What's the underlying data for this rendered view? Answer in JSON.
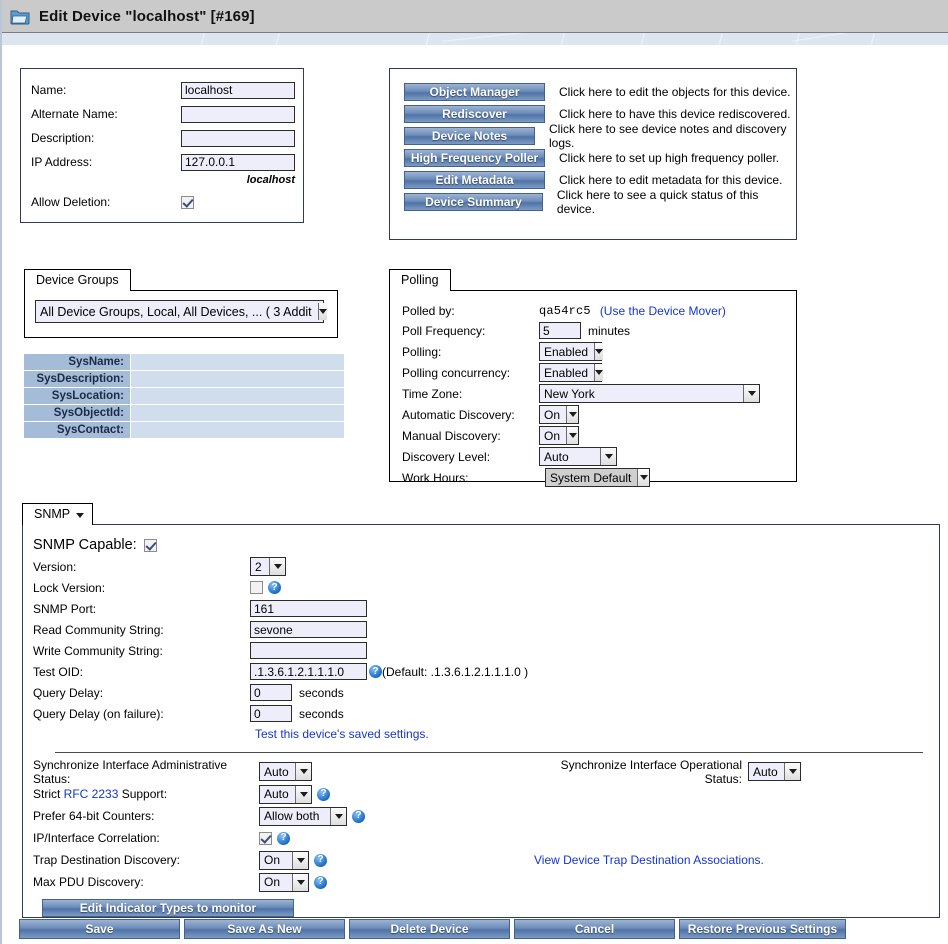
{
  "window": {
    "title": "Edit Device \"localhost\" [#169]",
    "icon": "folder-icon"
  },
  "device_info": {
    "fields": [
      {
        "label": "Name:",
        "value": "localhost",
        "placeholder": ""
      },
      {
        "label": "Alternate Name:",
        "value": "",
        "placeholder": ""
      },
      {
        "label": "Description:",
        "value": "",
        "placeholder": ""
      },
      {
        "label": "IP Address:",
        "value": "127.0.0.1",
        "placeholder": ""
      }
    ],
    "resolved_host": "localhost",
    "allow_deletion_label": "Allow Deletion:",
    "allow_deletion_checked": true
  },
  "actions": [
    {
      "button": "Object Manager",
      "description": "Click here to edit the objects for this device."
    },
    {
      "button": "Rediscover",
      "description": "Click here to have this device rediscovered."
    },
    {
      "button": "Device Notes",
      "description": "Click here to see device notes and discovery logs."
    },
    {
      "button": "High Frequency Poller",
      "description": "Click here to set up high frequency poller."
    },
    {
      "button": "Edit Metadata",
      "description": "Click here to edit metadata for this device."
    },
    {
      "button": "Device Summary",
      "description": "Click here to see a quick status of this device."
    }
  ],
  "device_groups": {
    "tab_label": "Device Groups",
    "selected": "All Device Groups, Local, All Devices, ... ( 3 Addit"
  },
  "sys_table": [
    {
      "label": "SysName:",
      "value": ""
    },
    {
      "label": "SysDescription:",
      "value": ""
    },
    {
      "label": "SysLocation:",
      "value": ""
    },
    {
      "label": "SysObjectId:",
      "value": ""
    },
    {
      "label": "SysContact:",
      "value": ""
    }
  ],
  "polling": {
    "tab_label": "Polling",
    "polled_by_label": "Polled by:",
    "polled_by_value": "qa54rc5",
    "device_mover_link": "(Use the Device Mover)",
    "poll_frequency_label": "Poll Frequency:",
    "poll_frequency_value": "5",
    "poll_frequency_unit": "minutes",
    "polling_label": "Polling:",
    "polling_value": "Enabled",
    "concurrency_label": "Polling concurrency:",
    "concurrency_value": "Enabled",
    "timezone_label": "Time Zone:",
    "timezone_value": "New York",
    "auto_discovery_label": "Automatic Discovery:",
    "auto_discovery_value": "On",
    "manual_discovery_label": "Manual Discovery:",
    "manual_discovery_value": "On",
    "discovery_level_label": "Discovery Level:",
    "discovery_level_value": "Auto",
    "work_hours_label": "Work Hours:",
    "work_hours_value": "System Default"
  },
  "snmp": {
    "tab_label": "SNMP",
    "capable_label": "SNMP Capable:",
    "capable_checked": true,
    "version_label": "Version:",
    "version_value": "2",
    "lock_version_label": "Lock Version:",
    "lock_version_checked": false,
    "port_label": "SNMP Port:",
    "port_value": "161",
    "read_community_label": "Read Community String:",
    "read_community_value": "sevone",
    "write_community_label": "Write Community String:",
    "write_community_value": "",
    "test_oid_label": "Test OID:",
    "test_oid_value": ".1.3.6.1.2.1.1.1.0",
    "test_oid_default": "(Default: .1.3.6.1.2.1.1.1.0 )",
    "query_delay_label": "Query Delay:",
    "query_delay_value": "0",
    "query_delay_unit": "seconds",
    "query_delay_fail_label": "Query Delay (on failure):",
    "query_delay_fail_value": "0",
    "query_delay_fail_unit": "seconds",
    "test_settings_link": "Test this device's saved settings.",
    "sync_admin_label": "Synchronize Interface Administrative Status:",
    "sync_admin_value": "Auto",
    "sync_oper_label": "Synchronize Interface Operational Status:",
    "sync_oper_value": "Auto",
    "strict_rfc_label_pre": "Strict ",
    "strict_rfc_link": "RFC 2233",
    "strict_rfc_label_post": " Support:",
    "strict_rfc_value": "Auto",
    "prefer64_label": "Prefer 64-bit Counters:",
    "prefer64_value": "Allow both",
    "ip_correlation_label": "IP/Interface Correlation:",
    "ip_correlation_checked": true,
    "trap_dest_label": "Trap Destination Discovery:",
    "trap_dest_value": "On",
    "max_pdu_label": "Max PDU Discovery:",
    "max_pdu_value": "On",
    "trap_assoc_link": "View Device Trap Destination Associations.",
    "edit_indicator_button": "Edit Indicator Types to monitor"
  },
  "footer": {
    "buttons": [
      "Save",
      "Save As New",
      "Delete Device",
      "Cancel",
      "Restore Previous Settings"
    ]
  },
  "colors": {
    "titlebar": "#cacaca",
    "band": "#dde6f0",
    "panel_border": "#323a5e",
    "input_bg": "#eeeefb",
    "button_blue": "#4f73a6",
    "link": "#1535cf",
    "sys_label_bg": "#a4bcd7",
    "sys_value_bg": "#cfdded"
  }
}
